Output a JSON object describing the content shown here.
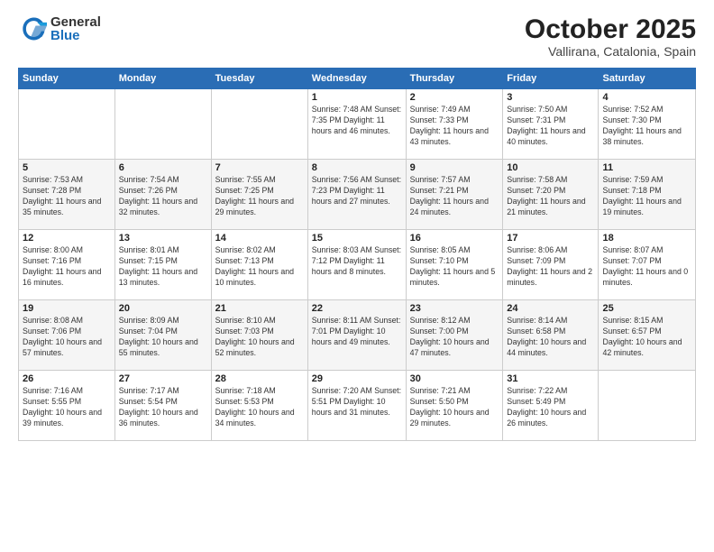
{
  "header": {
    "logo_general": "General",
    "logo_blue": "Blue",
    "month_title": "October 2025",
    "location": "Vallirana, Catalonia, Spain"
  },
  "weekdays": [
    "Sunday",
    "Monday",
    "Tuesday",
    "Wednesday",
    "Thursday",
    "Friday",
    "Saturday"
  ],
  "rows": [
    [
      {
        "day": "",
        "info": ""
      },
      {
        "day": "",
        "info": ""
      },
      {
        "day": "",
        "info": ""
      },
      {
        "day": "1",
        "info": "Sunrise: 7:48 AM\nSunset: 7:35 PM\nDaylight: 11 hours\nand 46 minutes."
      },
      {
        "day": "2",
        "info": "Sunrise: 7:49 AM\nSunset: 7:33 PM\nDaylight: 11 hours\nand 43 minutes."
      },
      {
        "day": "3",
        "info": "Sunrise: 7:50 AM\nSunset: 7:31 PM\nDaylight: 11 hours\nand 40 minutes."
      },
      {
        "day": "4",
        "info": "Sunrise: 7:52 AM\nSunset: 7:30 PM\nDaylight: 11 hours\nand 38 minutes."
      }
    ],
    [
      {
        "day": "5",
        "info": "Sunrise: 7:53 AM\nSunset: 7:28 PM\nDaylight: 11 hours\nand 35 minutes."
      },
      {
        "day": "6",
        "info": "Sunrise: 7:54 AM\nSunset: 7:26 PM\nDaylight: 11 hours\nand 32 minutes."
      },
      {
        "day": "7",
        "info": "Sunrise: 7:55 AM\nSunset: 7:25 PM\nDaylight: 11 hours\nand 29 minutes."
      },
      {
        "day": "8",
        "info": "Sunrise: 7:56 AM\nSunset: 7:23 PM\nDaylight: 11 hours\nand 27 minutes."
      },
      {
        "day": "9",
        "info": "Sunrise: 7:57 AM\nSunset: 7:21 PM\nDaylight: 11 hours\nand 24 minutes."
      },
      {
        "day": "10",
        "info": "Sunrise: 7:58 AM\nSunset: 7:20 PM\nDaylight: 11 hours\nand 21 minutes."
      },
      {
        "day": "11",
        "info": "Sunrise: 7:59 AM\nSunset: 7:18 PM\nDaylight: 11 hours\nand 19 minutes."
      }
    ],
    [
      {
        "day": "12",
        "info": "Sunrise: 8:00 AM\nSunset: 7:16 PM\nDaylight: 11 hours\nand 16 minutes."
      },
      {
        "day": "13",
        "info": "Sunrise: 8:01 AM\nSunset: 7:15 PM\nDaylight: 11 hours\nand 13 minutes."
      },
      {
        "day": "14",
        "info": "Sunrise: 8:02 AM\nSunset: 7:13 PM\nDaylight: 11 hours\nand 10 minutes."
      },
      {
        "day": "15",
        "info": "Sunrise: 8:03 AM\nSunset: 7:12 PM\nDaylight: 11 hours\nand 8 minutes."
      },
      {
        "day": "16",
        "info": "Sunrise: 8:05 AM\nSunset: 7:10 PM\nDaylight: 11 hours\nand 5 minutes."
      },
      {
        "day": "17",
        "info": "Sunrise: 8:06 AM\nSunset: 7:09 PM\nDaylight: 11 hours\nand 2 minutes."
      },
      {
        "day": "18",
        "info": "Sunrise: 8:07 AM\nSunset: 7:07 PM\nDaylight: 11 hours\nand 0 minutes."
      }
    ],
    [
      {
        "day": "19",
        "info": "Sunrise: 8:08 AM\nSunset: 7:06 PM\nDaylight: 10 hours\nand 57 minutes."
      },
      {
        "day": "20",
        "info": "Sunrise: 8:09 AM\nSunset: 7:04 PM\nDaylight: 10 hours\nand 55 minutes."
      },
      {
        "day": "21",
        "info": "Sunrise: 8:10 AM\nSunset: 7:03 PM\nDaylight: 10 hours\nand 52 minutes."
      },
      {
        "day": "22",
        "info": "Sunrise: 8:11 AM\nSunset: 7:01 PM\nDaylight: 10 hours\nand 49 minutes."
      },
      {
        "day": "23",
        "info": "Sunrise: 8:12 AM\nSunset: 7:00 PM\nDaylight: 10 hours\nand 47 minutes."
      },
      {
        "day": "24",
        "info": "Sunrise: 8:14 AM\nSunset: 6:58 PM\nDaylight: 10 hours\nand 44 minutes."
      },
      {
        "day": "25",
        "info": "Sunrise: 8:15 AM\nSunset: 6:57 PM\nDaylight: 10 hours\nand 42 minutes."
      }
    ],
    [
      {
        "day": "26",
        "info": "Sunrise: 7:16 AM\nSunset: 5:55 PM\nDaylight: 10 hours\nand 39 minutes."
      },
      {
        "day": "27",
        "info": "Sunrise: 7:17 AM\nSunset: 5:54 PM\nDaylight: 10 hours\nand 36 minutes."
      },
      {
        "day": "28",
        "info": "Sunrise: 7:18 AM\nSunset: 5:53 PM\nDaylight: 10 hours\nand 34 minutes."
      },
      {
        "day": "29",
        "info": "Sunrise: 7:20 AM\nSunset: 5:51 PM\nDaylight: 10 hours\nand 31 minutes."
      },
      {
        "day": "30",
        "info": "Sunrise: 7:21 AM\nSunset: 5:50 PM\nDaylight: 10 hours\nand 29 minutes."
      },
      {
        "day": "31",
        "info": "Sunrise: 7:22 AM\nSunset: 5:49 PM\nDaylight: 10 hours\nand 26 minutes."
      },
      {
        "day": "",
        "info": ""
      }
    ]
  ]
}
